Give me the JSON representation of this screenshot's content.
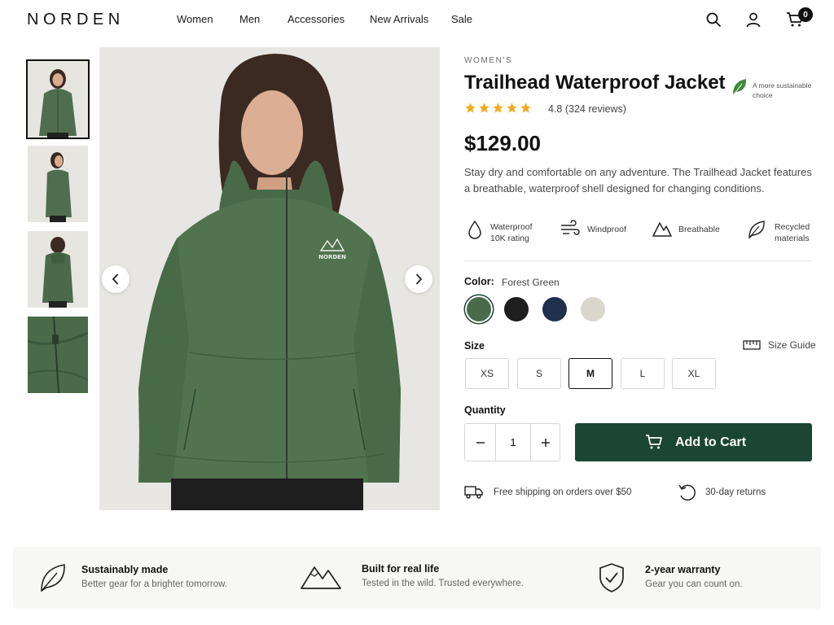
{
  "brand": {
    "logo": "NORDEN"
  },
  "nav": {
    "items": [
      {
        "label": "Women"
      },
      {
        "label": "Men"
      },
      {
        "label": "Accessories"
      },
      {
        "label": "New Arrivals"
      },
      {
        "label": "Sale"
      }
    ]
  },
  "header_icons": {
    "search": "search-icon",
    "account": "user-icon",
    "cart": "cart-icon",
    "cart_count": "0"
  },
  "gallery": {
    "thumbnails": [
      {
        "name": "front view",
        "active": true
      },
      {
        "name": "side view",
        "active": false
      },
      {
        "name": "back view",
        "active": false
      },
      {
        "name": "zipper detail",
        "active": false
      }
    ],
    "main_image_logo_text": "NORDEN",
    "prev_icon": "chevron-left-icon",
    "next_icon": "chevron-right-icon"
  },
  "product": {
    "category": "WOMEN'S",
    "title": "Trailhead Waterproof Jacket",
    "sustainable_badge": "A more sustainable choice",
    "rating_value": 4.8,
    "rating_text": "4.8 (324 reviews)",
    "stars": 5,
    "price": "$129.00",
    "description": "Stay dry and comfortable on any adventure. The Trailhead Jacket features a breathable, waterproof shell designed for changing conditions.",
    "features": [
      {
        "icon": "water-drop-icon",
        "line1": "Waterproof",
        "line2": "10K rating"
      },
      {
        "icon": "wind-icon",
        "line1": "Windproof",
        "line2": ""
      },
      {
        "icon": "mountain-icon",
        "line1": "Breathable",
        "line2": ""
      },
      {
        "icon": "leaf-icon",
        "line1": "Recycled",
        "line2": "materials"
      }
    ]
  },
  "color": {
    "label": "Color:",
    "selected": "Forest Green",
    "swatches": [
      {
        "name": "Forest Green",
        "hex": "#4a6b4a",
        "selected": true
      },
      {
        "name": "Black",
        "hex": "#1e1e1e",
        "selected": false
      },
      {
        "name": "Navy",
        "hex": "#1f2f4d",
        "selected": false
      },
      {
        "name": "Stone",
        "hex": "#d9d6cc",
        "selected": false
      }
    ]
  },
  "size": {
    "label": "Size",
    "guide_label": "Size Guide",
    "options": [
      "XS",
      "S",
      "M",
      "L",
      "XL"
    ],
    "selected": "M"
  },
  "quantity": {
    "label": "Quantity",
    "value": "1",
    "minus": "−",
    "plus": "+"
  },
  "cta": {
    "add_to_cart": "Add to Cart"
  },
  "perks": [
    {
      "icon": "truck-icon",
      "text": "Free shipping on orders over $50"
    },
    {
      "icon": "return-icon",
      "text": "30-day returns"
    }
  ],
  "values": [
    {
      "icon": "leaf-icon",
      "title": "Sustainably made",
      "subtitle": "Better gear for a brighter tomorrow."
    },
    {
      "icon": "mountain-icon",
      "title": "Built for real life",
      "subtitle": "Tested in the wild. Trusted everywhere."
    },
    {
      "icon": "shield-check-icon",
      "title": "2-year warranty",
      "subtitle": "Gear you can count on."
    }
  ],
  "colors": {
    "accent": "#1b4535",
    "star": "#f2a91f",
    "leaf": "#3f8a3a"
  }
}
